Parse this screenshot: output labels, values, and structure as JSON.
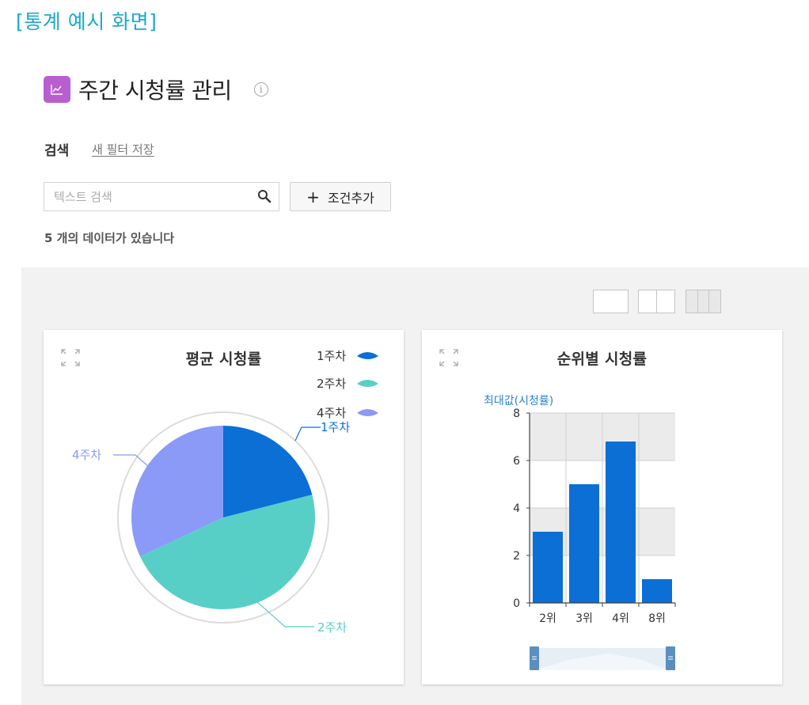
{
  "caption": "[통계 예시 화면]",
  "page": {
    "title": "주간 시청률 관리",
    "icon": "line-chart-icon",
    "accent_color": "#b85fd0"
  },
  "search": {
    "label": "검색",
    "filter_link": "새 필터 저장",
    "placeholder": "텍스트 검색",
    "add_condition_label": "조건추가",
    "result_text": "5 개의 데이터가 있습니다"
  },
  "layout_options": [
    "one-column",
    "two-column",
    "three-column"
  ],
  "cards": [
    {
      "title": "평균 시청률",
      "chart_data": {
        "type": "pie",
        "categories": [
          "1주차",
          "2주차",
          "4주차"
        ],
        "values": [
          21,
          47,
          32
        ],
        "colors": [
          "#0b6fd6",
          "#58cfc6",
          "#8b9af7"
        ],
        "legend": [
          "1주차",
          "2주차",
          "4주차"
        ],
        "legend_position": "top-right",
        "slice_labels": [
          "1주차",
          "2주차",
          "4주차"
        ]
      }
    },
    {
      "title": "순위별 시청률",
      "chart_data": {
        "type": "bar",
        "ylabel": "최대값(시청률)",
        "categories": [
          "2위",
          "3위",
          "4위",
          "8위"
        ],
        "values": [
          3,
          5,
          6.8,
          1
        ],
        "ylim": [
          0,
          8
        ],
        "yticks": [
          "0",
          "2",
          "4",
          "6",
          "8"
        ],
        "grid": true,
        "color": "#0b6fd6",
        "has_range_slider": true
      }
    }
  ]
}
